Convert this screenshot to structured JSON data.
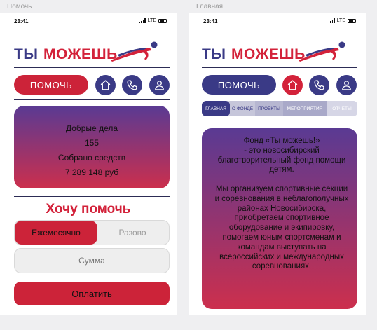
{
  "frames": {
    "left_label": "Помочь",
    "right_label": "Главная"
  },
  "status": {
    "time": "23:41",
    "network": "LTE"
  },
  "logo": {
    "part1": "ТЫ",
    "part2": "МОЖЕШЬ"
  },
  "left_screen": {
    "help_button": "ПОМОЧЬ",
    "stats": {
      "good_deeds_label": "Добрые дела",
      "good_deeds_value": "155",
      "funds_label": "Собрано средств",
      "funds_value": "7 289 148 руб"
    },
    "want_help_title": "Хочу помочь",
    "frequency": {
      "selected": "Ежемесячно",
      "other": "Разово"
    },
    "amount_placeholder": "Сумма",
    "pay_button": "Оплатить"
  },
  "right_screen": {
    "help_button": "ПОМОЧЬ",
    "tabs": [
      "ГЛАВНАЯ",
      "О ФОНДЕ",
      "ПРОЕКТЫ",
      "МЕРОПРИЯТИЯ",
      "ОТЧЕТЫ"
    ],
    "active_tab": "ГЛАВНАЯ",
    "about": "Фонд «Ты можешь!»\n- это новосибирский благотворительный фонд помощи детям.\n\nМы организуем спортивные секции и соревнования в неблагополучных районах Новосибирска, приобретаем спортивное оборудование и экипировку, помогаем юным спортсменам и командам выступать на всероссийских и международных соревнованиях."
  },
  "icons": [
    "home-icon",
    "phone-icon",
    "user-icon"
  ],
  "colors": {
    "brand_red": "#d3223a",
    "brand_navy": "#3a3a86",
    "gradient_top": "#5a3a93",
    "gradient_bottom": "#cc2f4d"
  }
}
